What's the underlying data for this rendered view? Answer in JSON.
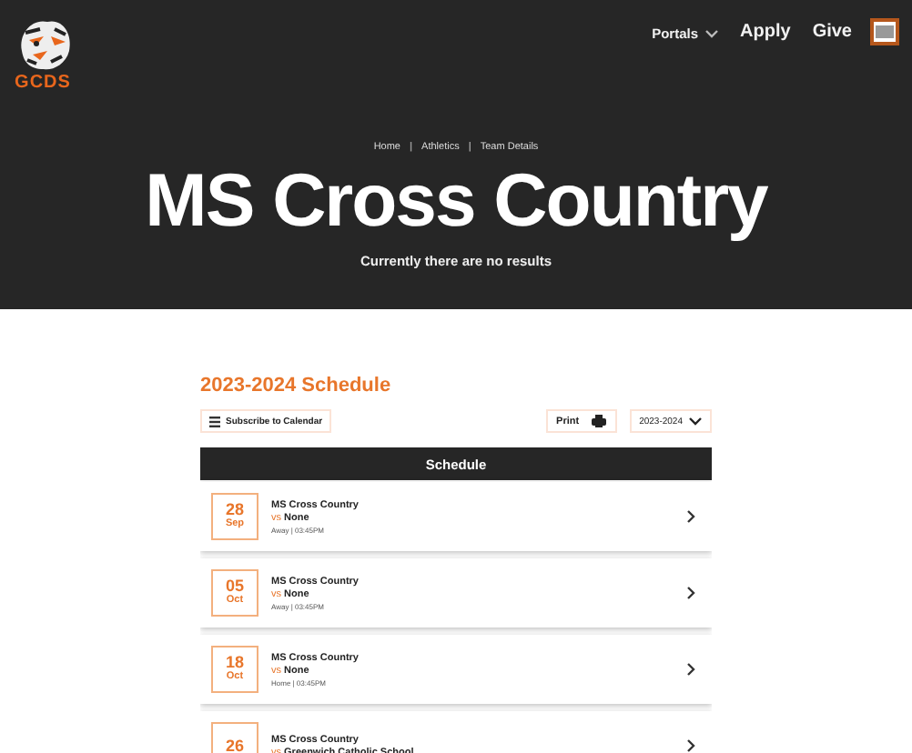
{
  "header": {
    "logo_text": "GCDS",
    "nav": [
      {
        "label": "Portals",
        "kind": "dropdown"
      },
      {
        "label": "Apply",
        "kind": "link"
      },
      {
        "label": "Give",
        "kind": "link"
      }
    ]
  },
  "hero": {
    "breadcrumb": [
      {
        "kind": "link",
        "text": "Home"
      },
      {
        "kind": "separator",
        "text": "|"
      },
      {
        "kind": "link",
        "text": "Athletics"
      },
      {
        "kind": "separator",
        "text": "|"
      },
      {
        "kind": "link",
        "text": "Team Details"
      }
    ],
    "title": "MS Cross Country",
    "subtitle": "Currently there are no results"
  },
  "schedule": {
    "heading": "2023-2024 Schedule",
    "subscribe": "Subscribe to Calendar",
    "print": "Print",
    "season": "2023-2024",
    "table_title": "Schedule",
    "events": [
      {
        "day": "28",
        "month": "Sep",
        "team": "MS Cross Country",
        "vs": "vs",
        "opponent": "None",
        "details": "Away | 03:45PM"
      },
      {
        "day": "05",
        "month": "Oct",
        "team": "MS Cross Country",
        "vs": "vs",
        "opponent": "None",
        "details": "Away | 03:45PM"
      },
      {
        "day": "18",
        "month": "Oct",
        "team": "MS Cross Country",
        "vs": "vs",
        "opponent": "None",
        "details": "Home | 03:45PM"
      },
      {
        "day": "26",
        "team": "MS Cross Country",
        "vs": "vs",
        "opponent": "Greenwich Catholic School"
      }
    ]
  }
}
